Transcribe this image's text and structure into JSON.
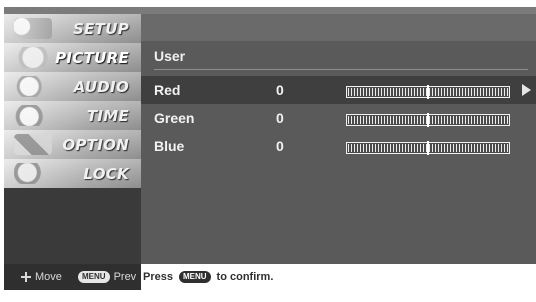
{
  "sidebar": {
    "items": [
      {
        "label": "SETUP",
        "icon": "setup-icon"
      },
      {
        "label": "PICTURE",
        "icon": "picture-icon"
      },
      {
        "label": "AUDIO",
        "icon": "audio-icon"
      },
      {
        "label": "TIME",
        "icon": "time-icon"
      },
      {
        "label": "OPTION",
        "icon": "option-icon"
      },
      {
        "label": "LOCK",
        "icon": "lock-icon"
      }
    ],
    "footer": {
      "move_label": "Move",
      "menu_key": "MENU",
      "prev_label": "Prev"
    }
  },
  "panel": {
    "title": "User",
    "rows": [
      {
        "name": "Red",
        "value": "0",
        "level": 0.5,
        "has_arrow": true
      },
      {
        "name": "Green",
        "value": "0",
        "level": 0.5,
        "has_arrow": false
      },
      {
        "name": "Blue",
        "value": "0",
        "level": 0.5,
        "has_arrow": false
      }
    ],
    "confirm": {
      "press": "Press",
      "menu_key": "MENU",
      "suffix": "to confirm."
    }
  }
}
